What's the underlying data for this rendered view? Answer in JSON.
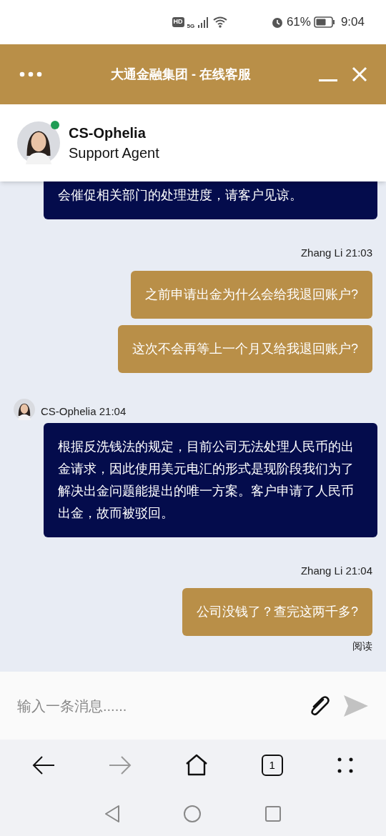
{
  "status_bar": {
    "hd": "HD",
    "network": "5G",
    "battery": "61%",
    "time": "9:04"
  },
  "header": {
    "title": "大通金融集团 - 在线客服"
  },
  "agent": {
    "name": "CS-Ophelia",
    "role": "Support Agent",
    "online": true
  },
  "messages": [
    {
      "kind": "agent",
      "texts": [
        "会催促相关部门的处理进度，请客户见谅。"
      ]
    },
    {
      "kind": "user",
      "sender": "Zhang Li 21:03",
      "texts": [
        "之前申请出金为什么会给我退回账户?",
        "这次不会再等上一个月又给我退回账户?"
      ]
    },
    {
      "kind": "agent",
      "sender": "CS-Ophelia 21:04",
      "texts": [
        "根据反洗钱法的规定，目前公司无法处理人民币的出金请求，因此使用美元电汇的形式是现阶段我们为了解决出金问题能提出的唯一方案。客户申请了人民币出金，故而被驳回。"
      ]
    },
    {
      "kind": "user",
      "sender": "Zhang Li 21:04",
      "texts": [
        "公司没钱了？查完这两千多?"
      ],
      "receipt": "阅读"
    }
  ],
  "composer": {
    "placeholder": "输入一条消息......"
  },
  "browser_bar": {
    "tabs": "1"
  }
}
